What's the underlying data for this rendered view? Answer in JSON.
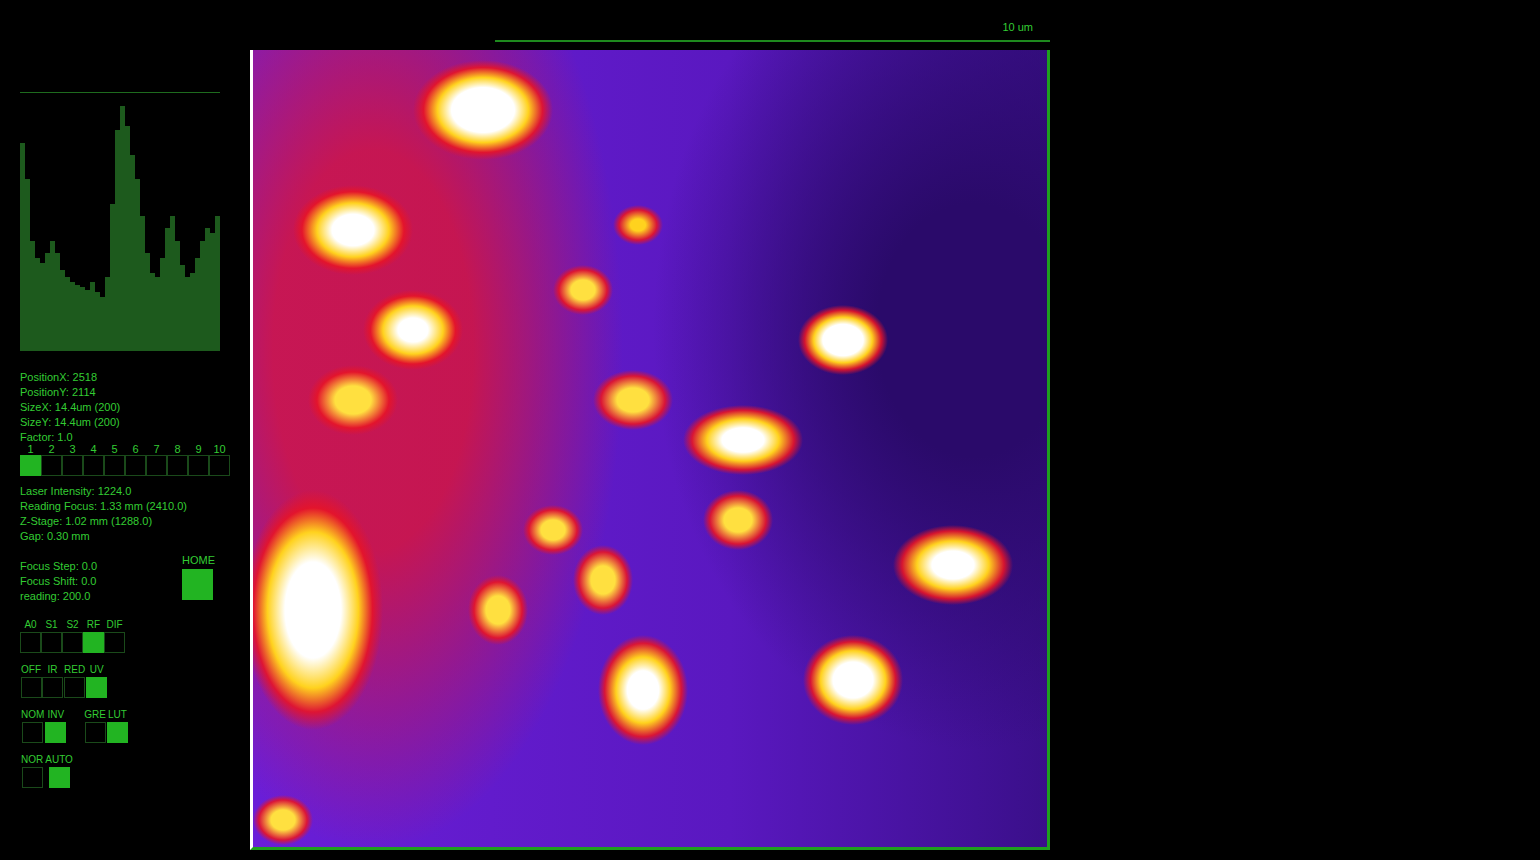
{
  "scale_bar": {
    "label": "10 um"
  },
  "histogram": {
    "values": [
      85,
      70,
      45,
      38,
      36,
      40,
      45,
      40,
      33,
      30,
      28,
      27,
      26,
      25,
      28,
      24,
      22,
      30,
      60,
      90,
      100,
      92,
      80,
      70,
      55,
      40,
      32,
      30,
      38,
      50,
      55,
      45,
      35,
      30,
      32,
      38,
      45,
      50,
      48,
      55
    ]
  },
  "info": [
    "PositionX: 2518",
    "PositionY: 2114",
    "SizeX: 14.4um (200)",
    "SizeY: 14.4um (200)",
    "Factor: 1.0"
  ],
  "channels": [
    {
      "label": "1",
      "selected": true
    },
    {
      "label": "2",
      "selected": false
    },
    {
      "label": "3",
      "selected": false
    },
    {
      "label": "4",
      "selected": false
    },
    {
      "label": "5",
      "selected": false
    },
    {
      "label": "6",
      "selected": false
    },
    {
      "label": "7",
      "selected": false
    },
    {
      "label": "8",
      "selected": false
    },
    {
      "label": "9",
      "selected": false
    },
    {
      "label": "10",
      "selected": false
    }
  ],
  "settings": [
    "Laser Intensity: 1224.0",
    "Reading Focus: 1.33 mm (2410.0)",
    "Z-Stage: 1.02 mm (1288.0)",
    "Gap: 0.30 mm"
  ],
  "focus": [
    "Focus Step: 0.0",
    "Focus Shift: 0.0",
    "reading: 200.0"
  ],
  "home_button": {
    "label": "HOME"
  },
  "toggle_rows": [
    {
      "groups": [
        {
          "options": [
            {
              "label": "A0",
              "selected": false
            },
            {
              "label": "S1",
              "selected": false
            },
            {
              "label": "S2",
              "selected": false
            },
            {
              "label": "RF",
              "selected": true
            },
            {
              "label": "DIF",
              "selected": false
            }
          ]
        }
      ]
    },
    {
      "groups": [
        {
          "options": [
            {
              "label": "OFF",
              "selected": false
            },
            {
              "label": "IR",
              "selected": false
            },
            {
              "label": "RED",
              "selected": false
            },
            {
              "label": "UV",
              "selected": true
            }
          ]
        }
      ]
    },
    {
      "groups": [
        {
          "options": [
            {
              "label": "NOM",
              "selected": false
            },
            {
              "label": "INV",
              "selected": true
            }
          ]
        },
        {
          "options": [
            {
              "label": "GRE",
              "selected": false
            },
            {
              "label": "LUT",
              "selected": true
            }
          ]
        }
      ]
    },
    {
      "groups": [
        {
          "options": [
            {
              "label": "NOR",
              "selected": false
            },
            {
              "label": "AUTO",
              "selected": true
            }
          ]
        }
      ]
    }
  ]
}
